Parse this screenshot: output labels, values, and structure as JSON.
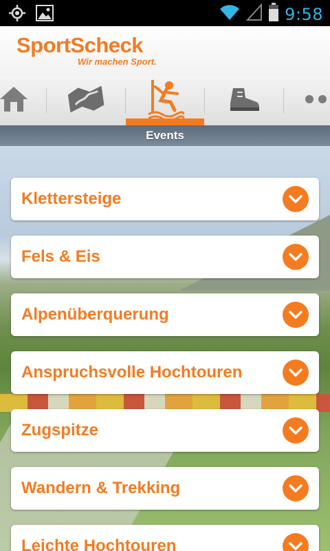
{
  "status_bar": {
    "time": "9:58",
    "icons": [
      "gps-icon",
      "image-icon",
      "wifi-icon",
      "signal-icon",
      "battery-icon"
    ]
  },
  "header": {
    "logo_text": "SportScheck",
    "tagline": "Wir machen Sport."
  },
  "nav": {
    "items": [
      {
        "icon": "home-icon",
        "active": false
      },
      {
        "icon": "map-icon",
        "active": false
      },
      {
        "icon": "climbing-icon",
        "active": true
      },
      {
        "icon": "hiking-boot-icon",
        "active": false
      },
      {
        "icon": "more-icon",
        "active": false
      }
    ]
  },
  "section": {
    "title": "Events"
  },
  "events": [
    {
      "label": "Klettersteige"
    },
    {
      "label": "Fels & Eis"
    },
    {
      "label": "Alpenüberquerung"
    },
    {
      "label": "Anspruchsvolle Hochtouren"
    },
    {
      "label": "Zugspitze"
    },
    {
      "label": "Wandern & Trekking"
    },
    {
      "label": "Leichte Hochtouren"
    }
  ],
  "colors": {
    "accent": "#f47b20",
    "section_bar": "#6b7a8a",
    "clock": "#33b5e5"
  }
}
